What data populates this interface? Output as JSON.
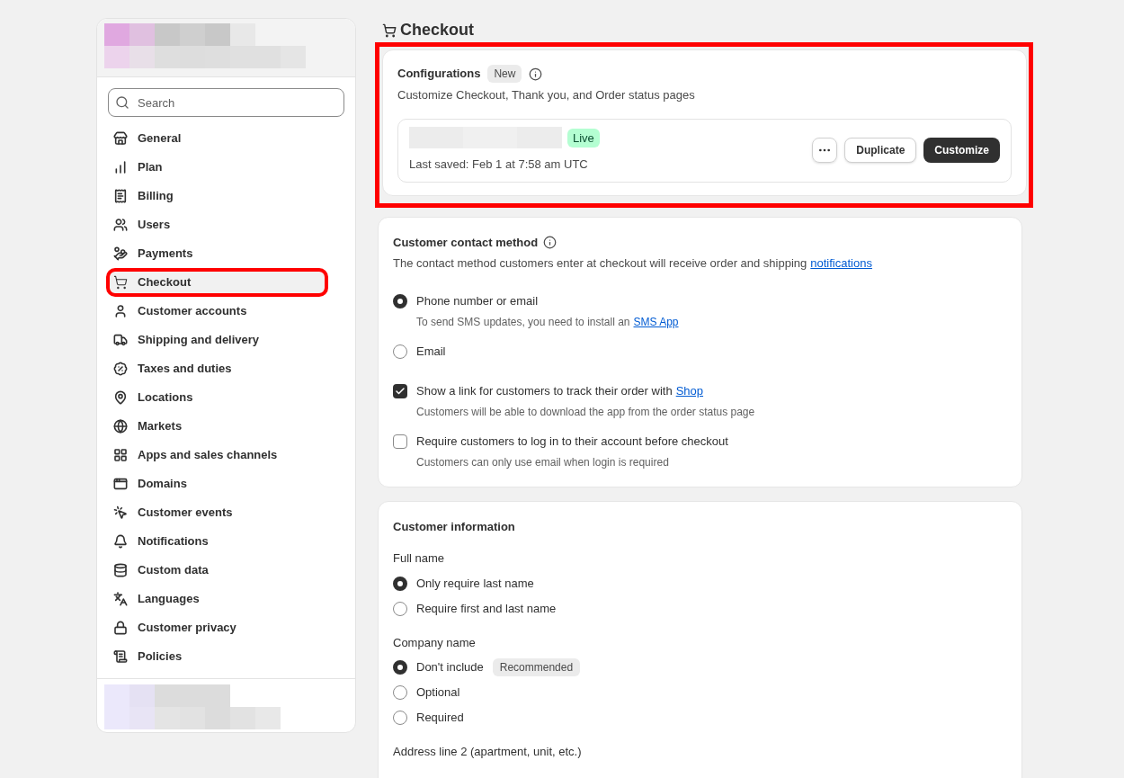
{
  "sidebar": {
    "search": {
      "placeholder": "Search"
    },
    "items": [
      {
        "label": "General",
        "selected": false
      },
      {
        "label": "Plan",
        "selected": false
      },
      {
        "label": "Billing",
        "selected": false
      },
      {
        "label": "Users",
        "selected": false
      },
      {
        "label": "Payments",
        "selected": false
      },
      {
        "label": "Checkout",
        "selected": true
      },
      {
        "label": "Customer accounts",
        "selected": false
      },
      {
        "label": "Shipping and delivery",
        "selected": false
      },
      {
        "label": "Taxes and duties",
        "selected": false
      },
      {
        "label": "Locations",
        "selected": false
      },
      {
        "label": "Markets",
        "selected": false
      },
      {
        "label": "Apps and sales channels",
        "selected": false
      },
      {
        "label": "Domains",
        "selected": false
      },
      {
        "label": "Customer events",
        "selected": false
      },
      {
        "label": "Notifications",
        "selected": false
      },
      {
        "label": "Custom data",
        "selected": false
      },
      {
        "label": "Languages",
        "selected": false
      },
      {
        "label": "Customer privacy",
        "selected": false
      },
      {
        "label": "Policies",
        "selected": false
      }
    ]
  },
  "page_title": "Checkout",
  "configurations": {
    "title": "Configurations",
    "badge": "New",
    "subtitle": "Customize Checkout, Thank you, and Order status pages",
    "status": "Live",
    "last_saved": "Last saved: Feb 1 at 7:58 am UTC",
    "buttons": [
      {
        "label": "Duplicate",
        "kind": "secondary"
      },
      {
        "label": "Customize",
        "kind": "primary"
      }
    ]
  },
  "contact_method": {
    "title": "Customer contact method",
    "description": "The contact method customers enter at checkout will receive order and shipping",
    "link": "notifications",
    "options": [
      {
        "kind": "radio",
        "label": "Phone number or email",
        "selected": true,
        "help": "To send SMS updates, you need to install an",
        "help_link": "SMS App"
      },
      {
        "kind": "radio",
        "label": "Email",
        "selected": false
      },
      {
        "kind": "checkbox",
        "label": "Show a link for customers to track their order with",
        "link": "Shop",
        "checked": true,
        "help": "Customers will be able to download the app from the order status page"
      },
      {
        "kind": "checkbox",
        "label": "Require customers to log in to their account before checkout",
        "checked": false,
        "help": "Customers can only use email when login is required"
      }
    ]
  },
  "customer_information": {
    "title": "Customer information",
    "groups": [
      {
        "label": "Full name",
        "options": [
          {
            "label": "Only require last name",
            "selected": true
          },
          {
            "label": "Require first and last name",
            "selected": false
          }
        ]
      },
      {
        "label": "Company name",
        "options": [
          {
            "label": "Don't include",
            "selected": true,
            "badge": "Recommended"
          },
          {
            "label": "Optional",
            "selected": false
          },
          {
            "label": "Required",
            "selected": false
          }
        ]
      },
      {
        "label": "Address line 2 (apartment, unit, etc.)"
      }
    ]
  }
}
